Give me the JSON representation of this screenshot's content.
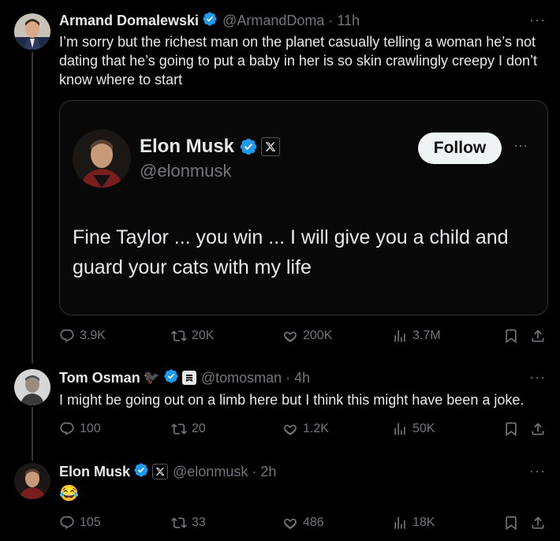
{
  "post1": {
    "name": "Armand Domalewski",
    "handle": "@ArmandDoma · 11h",
    "text": "I’m sorry but the richest man on the planet casually telling a woman he’s not dating that he’s going to put a baby in her is so skin crawlingly creepy I don’t know where to start",
    "more": "···",
    "quote": {
      "name": "Elon Musk",
      "handle": "@elonmusk",
      "follow_label": "Follow",
      "more": "···",
      "text": "Fine Taylor ... you win ... I will give you a child and guard your cats with my life"
    },
    "stats": {
      "replies": "3.9K",
      "reposts": "20K",
      "likes": "200K",
      "views": "3.7M"
    }
  },
  "post2": {
    "name": "Tom Osman",
    "bird": "🐦‍⬛",
    "handle": "@tomosman · 4h",
    "text": "I might be going out on a limb here but I think this might have been a joke.",
    "more": "···",
    "stats": {
      "replies": "100",
      "reposts": "20",
      "likes": "1.2K",
      "views": "50K"
    }
  },
  "post3": {
    "name": "Elon Musk",
    "handle": "@elonmusk · 2h",
    "text": "😂",
    "more": "···",
    "stats": {
      "replies": "105",
      "reposts": "33",
      "likes": "486",
      "views": "18K"
    }
  },
  "colors": {
    "background": "#000000",
    "text": "#e7e9ea",
    "muted": "#71767b",
    "verified": "#1d9bf0",
    "border": "#2f3336"
  },
  "icons": [
    "reply-icon",
    "repost-icon",
    "like-icon",
    "views-icon",
    "bookmark-icon",
    "share-icon",
    "verified-badge-icon",
    "x-logo-icon",
    "substack-icon"
  ]
}
